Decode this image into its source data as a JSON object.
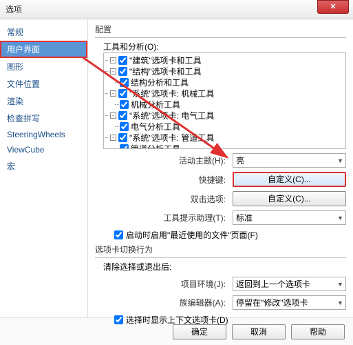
{
  "window": {
    "title": "选项"
  },
  "sidebar": {
    "items": [
      {
        "label": "常规"
      },
      {
        "label": "用户界面"
      },
      {
        "label": "图形"
      },
      {
        "label": "文件位置"
      },
      {
        "label": "渲染"
      },
      {
        "label": "检查拼写"
      },
      {
        "label": "SteeringWheels"
      },
      {
        "label": "ViewCube"
      },
      {
        "label": "宏"
      }
    ]
  },
  "config": {
    "group": "配置",
    "tools_label": "工具和分析(O):",
    "tree": [
      {
        "label": "\"建筑\"选项卡和工具"
      },
      {
        "label": "\"结构\"选项卡和工具"
      },
      {
        "label": "结构分析和工具"
      },
      {
        "label": "\"系统\"选项卡: 机械工具"
      },
      {
        "label": "机械分析工具"
      },
      {
        "label": "\"系统\"选项卡: 电气工具"
      },
      {
        "label": "电气分析工具"
      },
      {
        "label": "\"系统\"选项卡: 管道工具"
      },
      {
        "label": "管道分析工具"
      }
    ],
    "theme_label": "活动主题(H):",
    "theme_value": "亮",
    "shortcut_label": "快捷键:",
    "shortcut_btn": "自定义(C)...",
    "dbl_label": "双击选项:",
    "dbl_btn": "自定义(C)...",
    "tip_label": "工具提示助理(T):",
    "tip_value": "标准",
    "startup_chk": "启动时启用\"最近使用的文件\"页面(F)"
  },
  "tabswitch": {
    "group": "选项卡切换行为",
    "after_label": "清除选择或退出后:",
    "env_label": "项目环境(J):",
    "env_value": "返回到上一个选项卡",
    "fam_label": "族编辑器(A):",
    "fam_value": "停留在\"修改\"选项卡",
    "ctx_chk": "选择时显示上下文选项卡(D)"
  },
  "footer": {
    "ok": "确定",
    "cancel": "取消",
    "help": "帮助"
  }
}
